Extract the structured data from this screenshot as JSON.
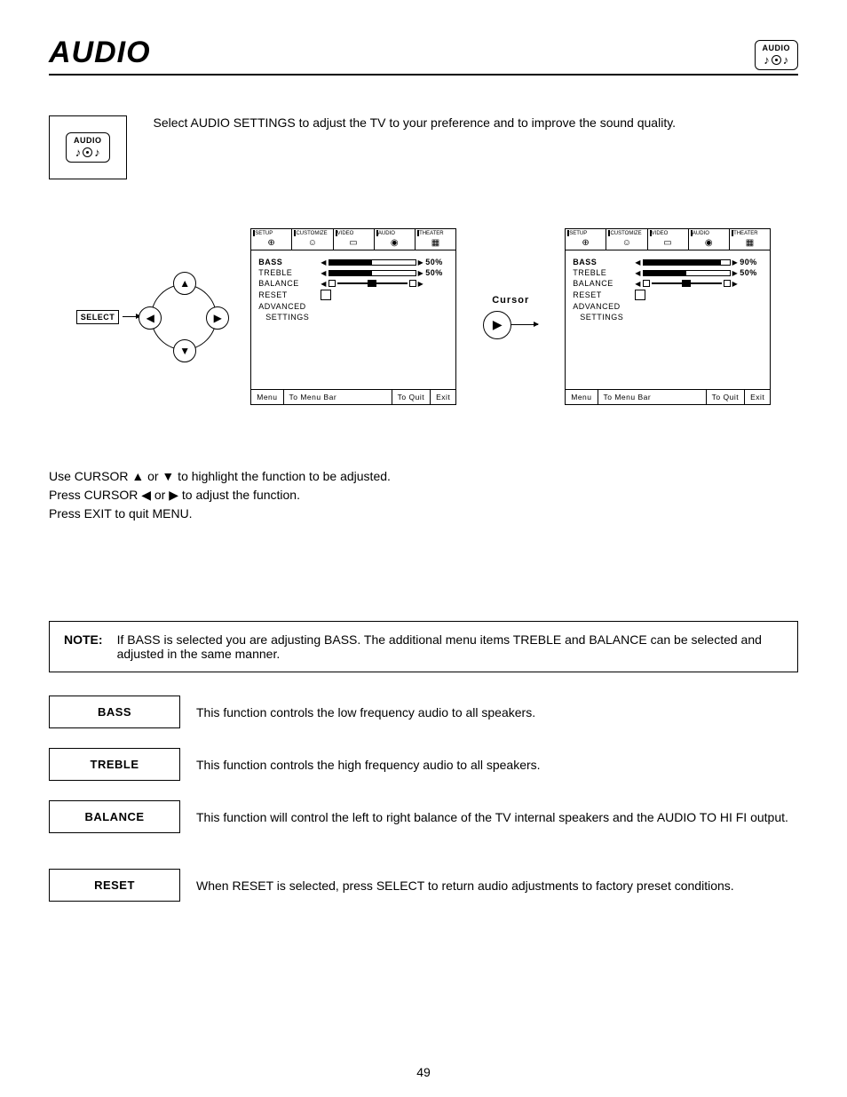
{
  "header": {
    "title": "AUDIO",
    "chip_label": "AUDIO"
  },
  "intro": "Select AUDIO SETTINGS to adjust the TV to your preference and to improve the sound quality.",
  "remote": {
    "select_label": "SELECT",
    "cursor_label": "Cursor"
  },
  "osd_tabs": [
    {
      "label": "SETUP",
      "icon": "⊕"
    },
    {
      "label": "CUSTOMIZE",
      "icon": "☺"
    },
    {
      "label": "VIDEO",
      "icon": "▭"
    },
    {
      "label": "AUDIO",
      "icon": "◉"
    },
    {
      "label": "THEATER",
      "icon": "▦"
    }
  ],
  "osd_left": {
    "rows": [
      {
        "name": "BASS",
        "type": "slider",
        "value": "50%",
        "fill": 50,
        "bold": true
      },
      {
        "name": "TREBLE",
        "type": "slider",
        "value": "50%",
        "fill": 50
      },
      {
        "name": "BALANCE",
        "type": "balance"
      },
      {
        "name": "RESET",
        "type": "check"
      },
      {
        "name": "ADVANCED",
        "type": "plain"
      },
      {
        "name": "SETTINGS",
        "type": "plain",
        "indent": true
      }
    ],
    "footer": {
      "menu": "Menu",
      "mid": "To Menu Bar",
      "quit": "To Quit",
      "exit": "Exit"
    }
  },
  "osd_right": {
    "rows": [
      {
        "name": "BASS",
        "type": "slider",
        "value": "90%",
        "fill": 90,
        "bold": true
      },
      {
        "name": "TREBLE",
        "type": "slider",
        "value": "50%",
        "fill": 50
      },
      {
        "name": "BALANCE",
        "type": "balance"
      },
      {
        "name": "RESET",
        "type": "check"
      },
      {
        "name": "ADVANCED",
        "type": "plain"
      },
      {
        "name": "SETTINGS",
        "type": "plain",
        "indent": true
      }
    ],
    "footer": {
      "menu": "Menu",
      "mid": "To Menu Bar",
      "quit": "To Quit",
      "exit": "Exit"
    }
  },
  "instructions": [
    "Use CURSOR ▲ or ▼ to highlight the function to be adjusted.",
    "Press CURSOR ◀ or ▶ to adjust the function.",
    "Press EXIT to quit MENU."
  ],
  "note": {
    "label": "NOTE:",
    "text": "If BASS is selected you are adjusting BASS.  The additional menu items TREBLE and BALANCE can be selected and adjusted in the same manner."
  },
  "definitions": [
    {
      "label": "BASS",
      "text": "This function controls the low frequency audio to all speakers."
    },
    {
      "label": "TREBLE",
      "text": "This function controls the high frequency audio to all speakers."
    },
    {
      "label": "BALANCE",
      "text": "This function will control the left to right balance of the TV internal speakers and the AUDIO TO HI FI output."
    },
    {
      "label": "RESET",
      "text": "When RESET is selected, press SELECT to return audio adjustments to factory preset conditions."
    }
  ],
  "page_number": "49"
}
